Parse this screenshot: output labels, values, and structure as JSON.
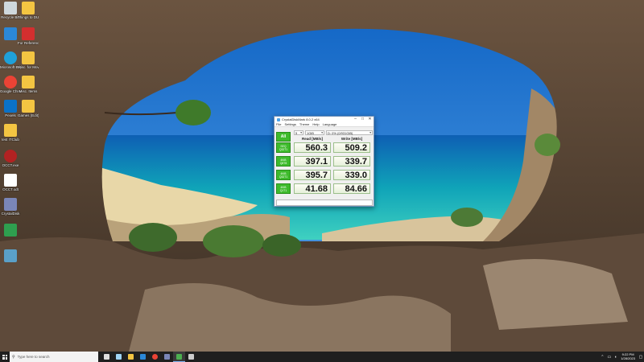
{
  "desktop": {
    "icons": [
      {
        "label": "Recycle Bin",
        "color": "#cfd8dc"
      },
      {
        "label": "Things to DUMP Chrome",
        "color": "#f4c542"
      },
      {
        "label": "",
        "color": "#2b88d8"
      },
      {
        "label": "For Reference",
        "color": "#d32f2f"
      },
      {
        "label": "Microsoft Edge",
        "color": "#1fa0d8"
      },
      {
        "label": "Misc. for Movie",
        "color": "#f4c542"
      },
      {
        "label": "Google Chrome",
        "color": "#ea4335"
      },
      {
        "label": "Misc. Items",
        "color": "#f4c542"
      },
      {
        "label": "Pexels",
        "color": "#0b72c7"
      },
      {
        "label": "Games (Edit)",
        "color": "#f4c542"
      },
      {
        "label": "test ITClub",
        "color": "#f4c542"
      },
      {
        "label": "OCCT.exe",
        "color": "#b22222"
      },
      {
        "label": "OCCT.odt",
        "color": "#ffffff"
      },
      {
        "label": "CrystalDisk",
        "color": "#7a86b8"
      },
      {
        "label": "",
        "color": "#2e9f4f"
      },
      {
        "label": "",
        "color": "#5aa0c8"
      }
    ]
  },
  "cdm": {
    "title": "CrystalDiskMark 8.0.2 x64",
    "menu": [
      "File",
      "Settings",
      "Theme",
      "Help",
      "Language"
    ],
    "all_label": "All",
    "count": "5",
    "size": "1GiB",
    "drive": "D: 0% (0/931GiB)",
    "read_header": "Read [MB/s]",
    "write_header": "Write [MB/s]",
    "rows": [
      {
        "label1": "SEQ",
        "label2": "Q32T1",
        "read": "560.3",
        "write": "509.2"
      },
      {
        "label1": "4KiB",
        "label2": "Q8T8",
        "read": "397.1",
        "write": "339.7"
      },
      {
        "label1": "4KiB",
        "label2": "Q32T1",
        "read": "395.7",
        "write": "339.0"
      },
      {
        "label1": "4KiB",
        "label2": "Q1T1",
        "read": "41.68",
        "write": "84.66"
      }
    ]
  },
  "taskbar": {
    "search_placeholder": "Type here to search",
    "apps": [
      {
        "name": "task-view",
        "color": "#dddddd"
      },
      {
        "name": "file-manager",
        "color": "#9fd4f5"
      },
      {
        "name": "explorer",
        "color": "#f4c542"
      },
      {
        "name": "store",
        "color": "#2b88d8"
      },
      {
        "name": "chrome",
        "color": "#ea4335"
      },
      {
        "name": "app",
        "color": "#7a86b8"
      },
      {
        "name": "crystaldiskmark",
        "color": "#4caf50"
      },
      {
        "name": "app2",
        "color": "#cccccc"
      }
    ],
    "time": "9:22 PM",
    "date": "1/28/2023"
  }
}
